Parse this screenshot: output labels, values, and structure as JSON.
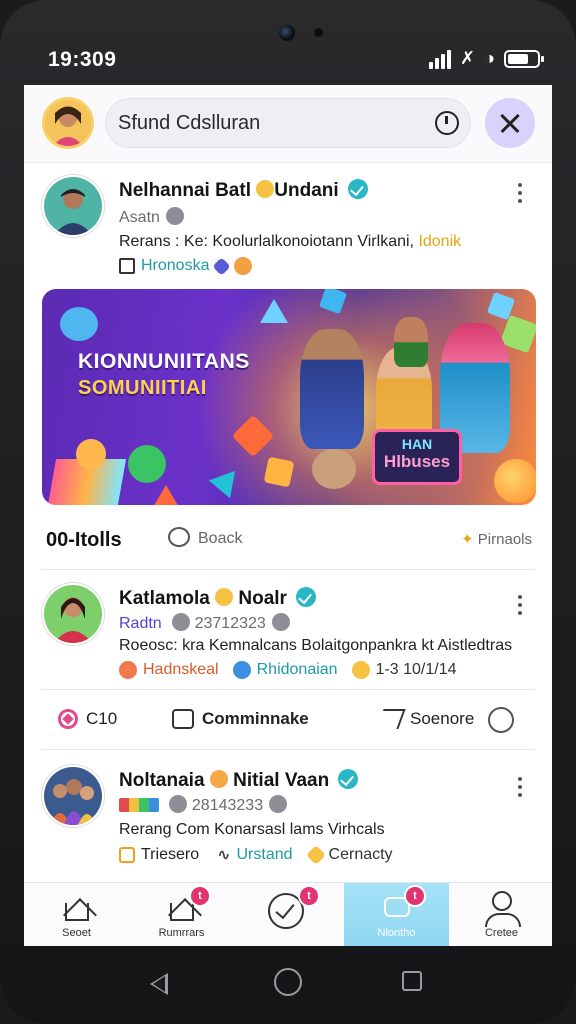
{
  "status_bar": {
    "time": "19:309"
  },
  "search": {
    "text": "Sfund Cdslluran"
  },
  "posts": [
    {
      "name": "Nelhannai Batl",
      "name_suffix": "Undani",
      "sub": "Asatn",
      "desc_prefix": "Rerans : Ke: Koolurlalkonoiotann Virlkani,",
      "desc_highlight": "Idonik",
      "tags": [
        "Hronoska"
      ]
    },
    {
      "name": "Katlamola",
      "name_suffix": "Noalr",
      "sub_left": "Radtn",
      "sub_right": "23712323",
      "desc": "Roeosc: kra  Kemnalcans  Bolaitgonpankra kt Aistledtras",
      "tags": [
        "Hadnskeal",
        "Rhidonaian",
        "1-3 10/1/14"
      ]
    },
    {
      "name": "Noltanaia",
      "name_suffix": "Nitial Vaan",
      "sub_right": "28143233",
      "desc": "Rerang Com Konarsasl lams Virhcals",
      "tags": [
        "Triesero",
        "Urstand",
        "Cernacty"
      ]
    }
  ],
  "banner": {
    "title_line1": "KIONNUNIITANS",
    "title_line2": "SOMUNIITIAI",
    "sign_line1": "HAN",
    "sign_line2": "Hlbuses"
  },
  "stats": {
    "count": "00-Itolls",
    "comment_label": "Boack",
    "pin_label": "Pirnaols"
  },
  "actions": {
    "like_count": "C10",
    "comment_label": "Comminnake",
    "share_label": "Soenore"
  },
  "bottom_nav": [
    {
      "label": "Seoet"
    },
    {
      "label": "Rumrrars",
      "badge": "t"
    },
    {
      "label": "",
      "badge": "t"
    },
    {
      "label": "Nlontho",
      "badge": "t"
    },
    {
      "label": "Cretee"
    }
  ],
  "colors": {
    "accent_purple": "#d9d2fb",
    "verified_teal": "#29b6c7",
    "badge_pink": "#e2356f",
    "active_nav": "#8fd6f1"
  }
}
